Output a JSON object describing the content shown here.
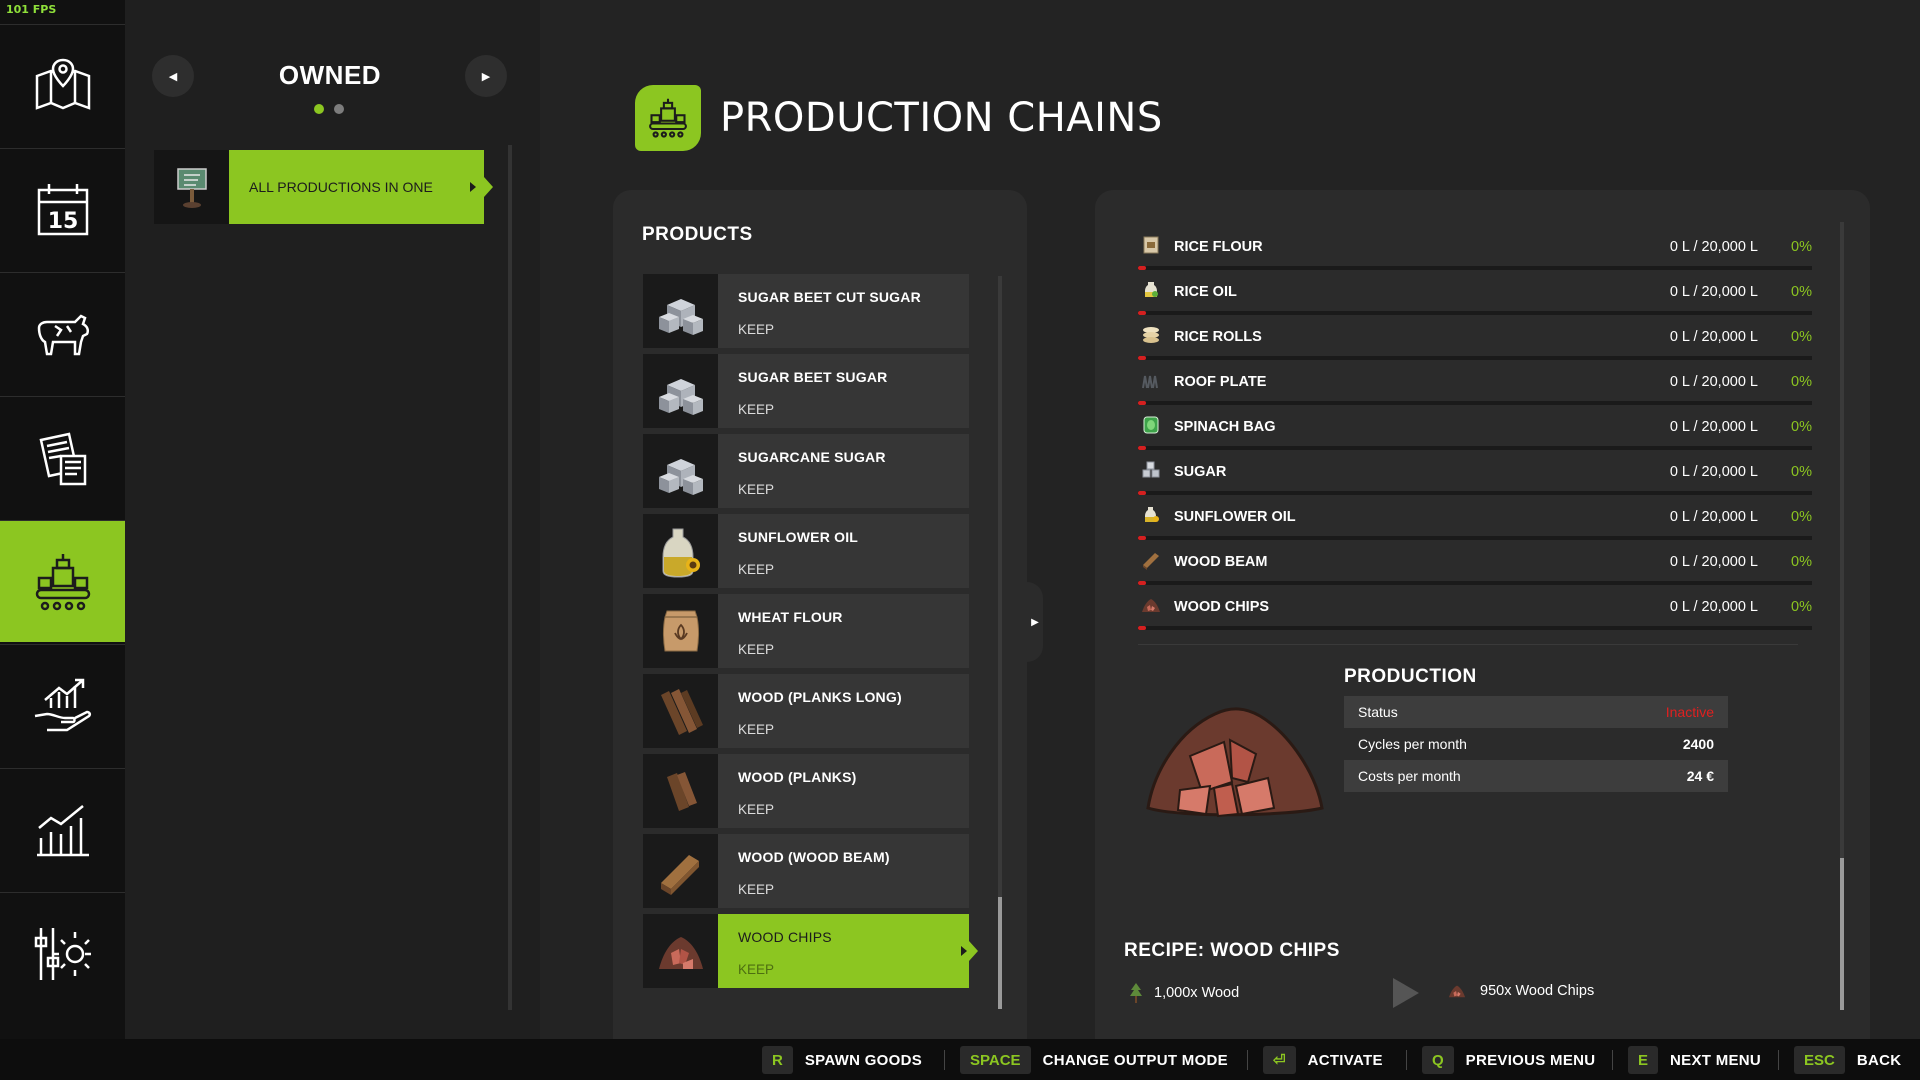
{
  "fps": "101 FPS",
  "owned": {
    "title": "OWNED",
    "prev_icon": "caret-left-icon",
    "next_icon": "caret-right-icon",
    "page_count": 2,
    "current_page": 1,
    "items": [
      {
        "label": "ALL PRODUCTIONS IN ONE"
      }
    ]
  },
  "header": {
    "title": "PRODUCTION CHAINS"
  },
  "products": {
    "title": "PRODUCTS",
    "items": [
      {
        "name": "SUGAR BEET CUT SUGAR",
        "mode": "KEEP",
        "icon": "sugar-cubes-icon"
      },
      {
        "name": "SUGAR BEET SUGAR",
        "mode": "KEEP",
        "icon": "sugar-cubes-icon"
      },
      {
        "name": "SUGARCANE SUGAR",
        "mode": "KEEP",
        "icon": "sugar-cubes-icon"
      },
      {
        "name": "SUNFLOWER OIL",
        "mode": "KEEP",
        "icon": "sunflower-oil-icon"
      },
      {
        "name": "WHEAT FLOUR",
        "mode": "KEEP",
        "icon": "flour-sack-icon"
      },
      {
        "name": "WOOD (PLANKS LONG)",
        "mode": "KEEP",
        "icon": "planks-long-icon"
      },
      {
        "name": "WOOD (PLANKS)",
        "mode": "KEEP",
        "icon": "planks-icon"
      },
      {
        "name": "WOOD (WOOD BEAM)",
        "mode": "KEEP",
        "icon": "wood-beam-icon"
      },
      {
        "name": "WOOD CHIPS",
        "mode": "KEEP",
        "icon": "wood-chips-icon"
      }
    ],
    "selected_index": 8
  },
  "storage": [
    {
      "name": "RICE FLOUR",
      "value": "0 L / 20,000 L",
      "pct": "0%",
      "fill": 0
    },
    {
      "name": "RICE OIL",
      "value": "0 L / 20,000 L",
      "pct": "0%",
      "fill": 0
    },
    {
      "name": "RICE ROLLS",
      "value": "0 L / 20,000 L",
      "pct": "0%",
      "fill": 0
    },
    {
      "name": "ROOF PLATE",
      "value": "0 L / 20,000 L",
      "pct": "0%",
      "fill": 0
    },
    {
      "name": "SPINACH BAG",
      "value": "0 L / 20,000 L",
      "pct": "0%",
      "fill": 0
    },
    {
      "name": "SUGAR",
      "value": "0 L / 20,000 L",
      "pct": "0%",
      "fill": 0
    },
    {
      "name": "SUNFLOWER OIL",
      "value": "0 L / 20,000 L",
      "pct": "0%",
      "fill": 0
    },
    {
      "name": "WOOD BEAM",
      "value": "0 L / 20,000 L",
      "pct": "0%",
      "fill": 0
    },
    {
      "name": "WOOD CHIPS",
      "value": "0 L / 20,000 L",
      "pct": "0%",
      "fill": 0
    }
  ],
  "production": {
    "title": "PRODUCTION",
    "rows": [
      {
        "label": "Status",
        "value": "Inactive"
      },
      {
        "label": "Cycles per month",
        "value": "2400"
      },
      {
        "label": "Costs per month",
        "value": "24 €"
      }
    ]
  },
  "recipe": {
    "title": "RECIPE: WOOD CHIPS",
    "input": "1,000x Wood",
    "output": "950x Wood Chips"
  },
  "hints": [
    {
      "key": "R",
      "label": "SPAWN GOODS"
    },
    {
      "key": "SPACE",
      "label": "CHANGE OUTPUT MODE"
    },
    {
      "key": "⏎",
      "label": "ACTIVATE"
    },
    {
      "key": "Q",
      "label": "PREVIOUS MENU"
    },
    {
      "key": "E",
      "label": "NEXT MENU"
    },
    {
      "key": "ESC",
      "label": "BACK"
    }
  ],
  "colors": {
    "accent": "#8cc621",
    "inactive": "#e02020",
    "background": "#232323"
  }
}
